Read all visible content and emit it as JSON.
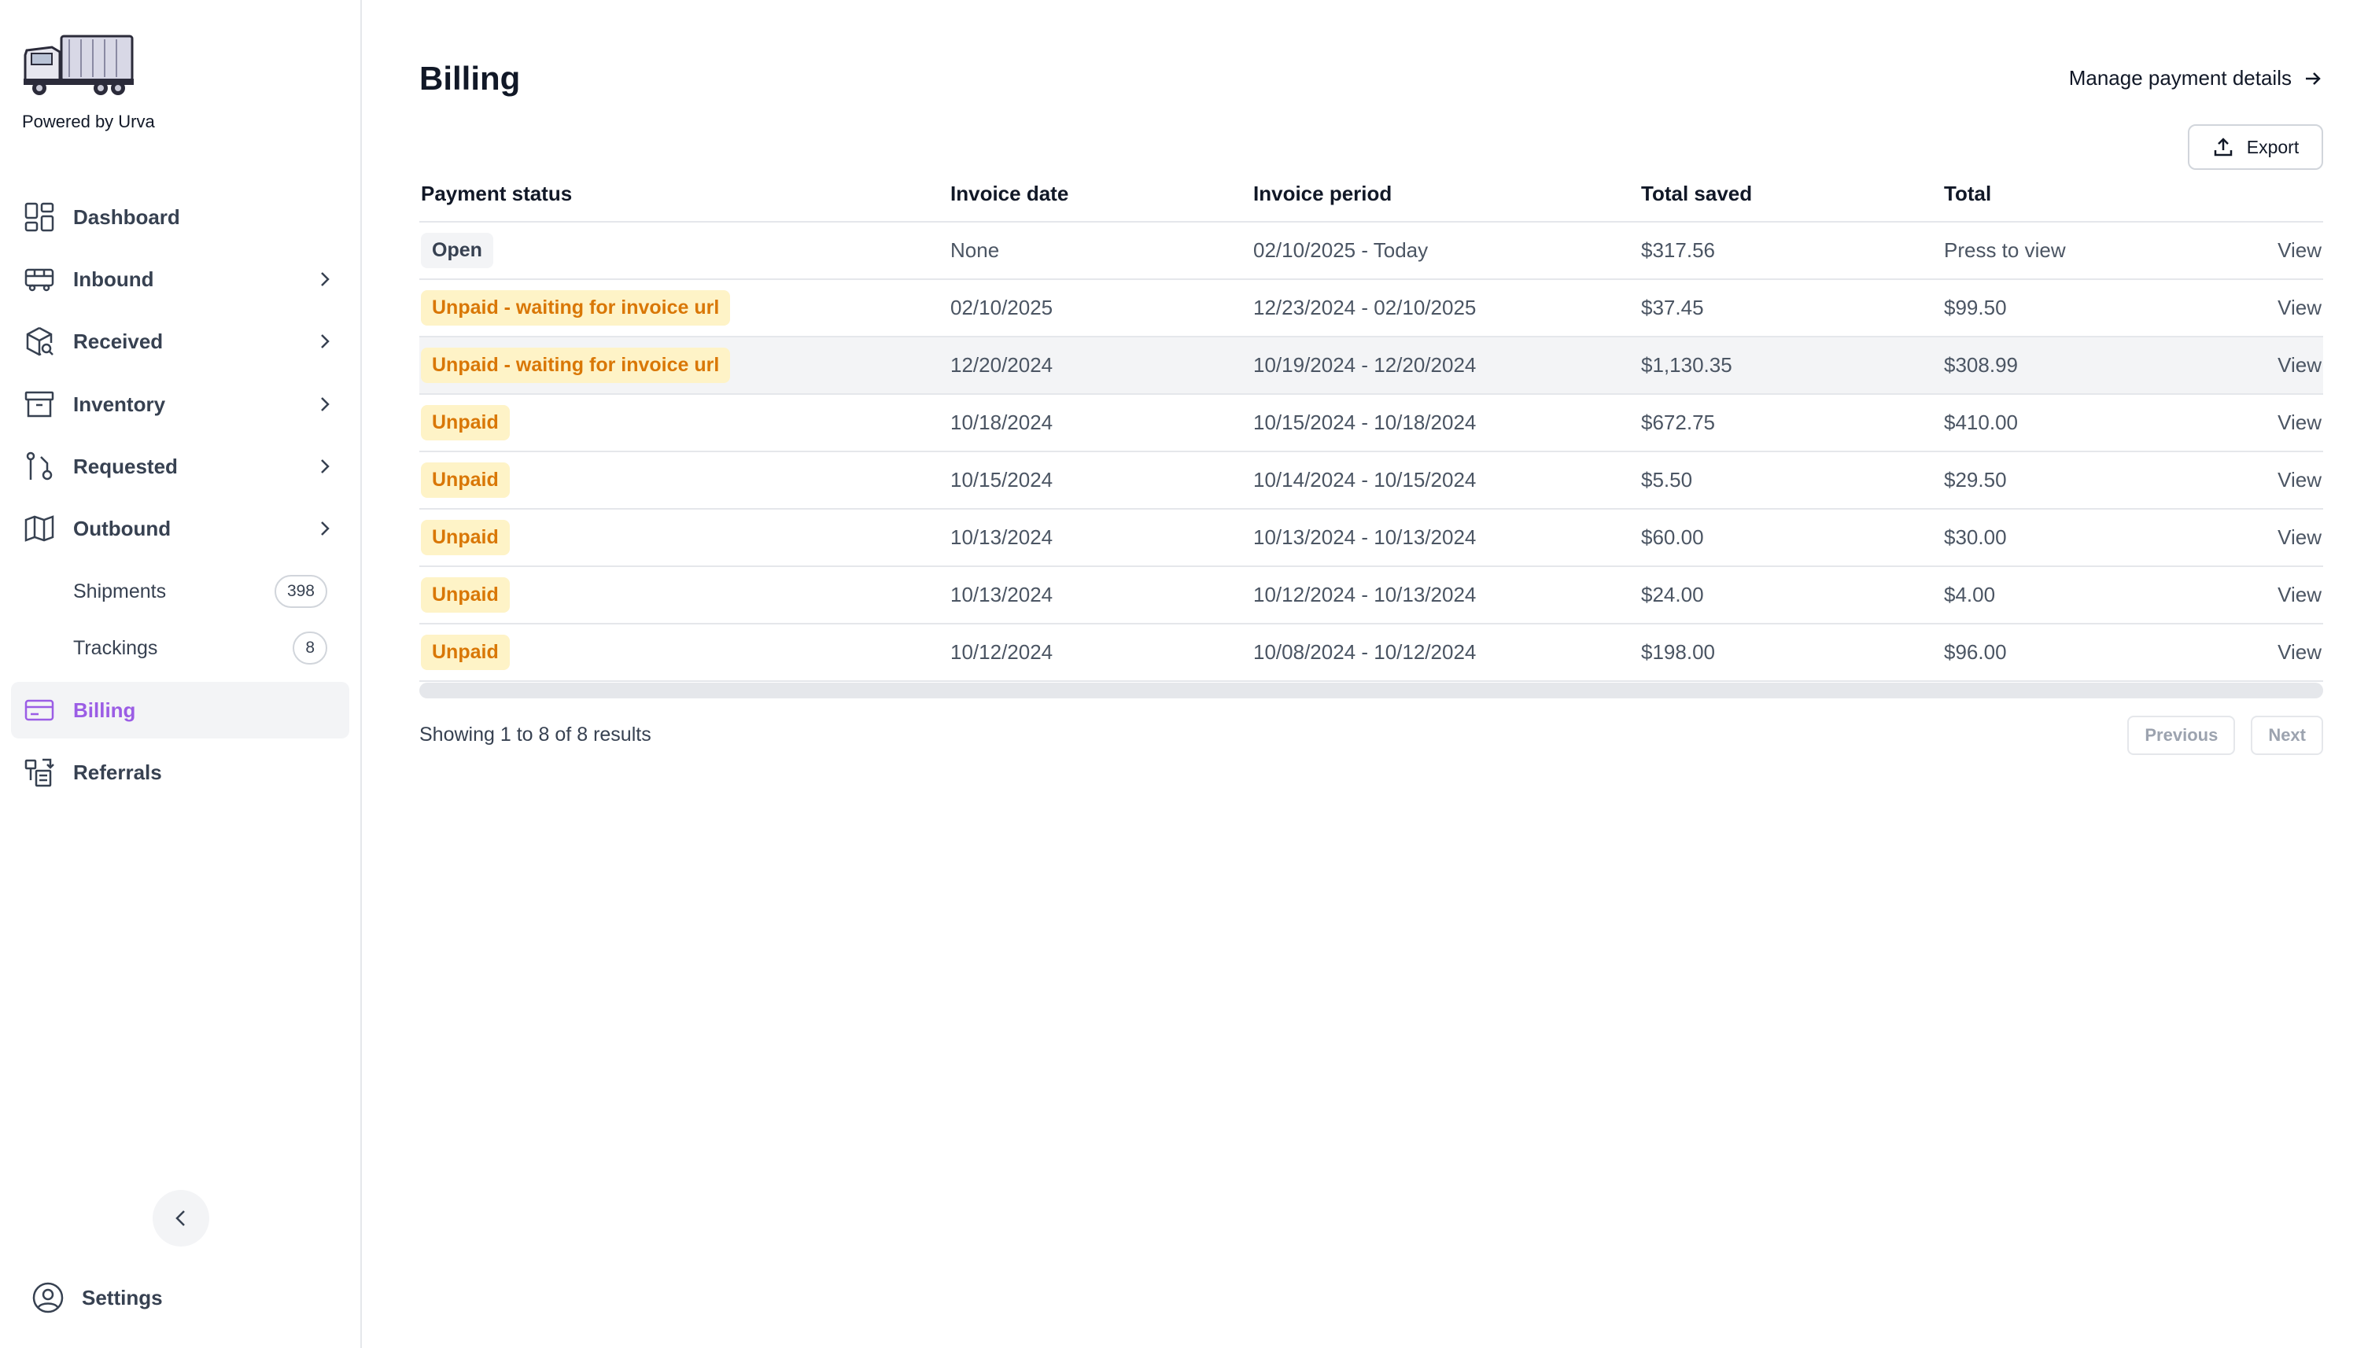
{
  "brand": {
    "tagline": "Powered by Urva",
    "logo_icon": "truck-icon"
  },
  "sidebar": {
    "items": [
      {
        "label": "Dashboard",
        "icon": "dashboard-grid-icon",
        "has_chevron": false
      },
      {
        "label": "Inbound",
        "icon": "bus-icon",
        "has_chevron": true
      },
      {
        "label": "Received",
        "icon": "package-search-icon",
        "has_chevron": true
      },
      {
        "label": "Inventory",
        "icon": "archive-box-icon",
        "has_chevron": true
      },
      {
        "label": "Requested",
        "icon": "git-pull-icon",
        "has_chevron": true
      },
      {
        "label": "Outbound",
        "icon": "map-folded-icon",
        "has_chevron": true
      }
    ],
    "sub_items": [
      {
        "label": "Shipments",
        "count": "398"
      },
      {
        "label": "Trackings",
        "count": "8"
      }
    ],
    "billing": {
      "label": "Billing",
      "icon": "credit-card-icon",
      "active": true
    },
    "referrals": {
      "label": "Referrals",
      "icon": "referral-icon"
    },
    "settings": {
      "label": "Settings",
      "icon": "user-circle-icon"
    },
    "collapse_icon": "chevron-left-icon"
  },
  "header": {
    "title": "Billing",
    "manage_link": "Manage payment details",
    "export_label": "Export"
  },
  "table": {
    "columns": [
      "Payment status",
      "Invoice date",
      "Invoice period",
      "Total saved",
      "Total",
      ""
    ],
    "rows": [
      {
        "status": "Open",
        "status_type": "open",
        "invoice_date": "None",
        "invoice_period": "02/10/2025 - Today",
        "total_saved": "$317.56",
        "total": "Press to view",
        "action": "View",
        "highlighted": false
      },
      {
        "status": "Unpaid - waiting for invoice url",
        "status_type": "unpaid",
        "invoice_date": "02/10/2025",
        "invoice_period": "12/23/2024 - 02/10/2025",
        "total_saved": "$37.45",
        "total": "$99.50",
        "action": "View",
        "highlighted": false
      },
      {
        "status": "Unpaid - waiting for invoice url",
        "status_type": "unpaid",
        "invoice_date": "12/20/2024",
        "invoice_period": "10/19/2024 - 12/20/2024",
        "total_saved": "$1,130.35",
        "total": "$308.99",
        "action": "View",
        "highlighted": true
      },
      {
        "status": "Unpaid",
        "status_type": "unpaid",
        "invoice_date": "10/18/2024",
        "invoice_period": "10/15/2024 - 10/18/2024",
        "total_saved": "$672.75",
        "total": "$410.00",
        "action": "View",
        "highlighted": false
      },
      {
        "status": "Unpaid",
        "status_type": "unpaid",
        "invoice_date": "10/15/2024",
        "invoice_period": "10/14/2024 - 10/15/2024",
        "total_saved": "$5.50",
        "total": "$29.50",
        "action": "View",
        "highlighted": false
      },
      {
        "status": "Unpaid",
        "status_type": "unpaid",
        "invoice_date": "10/13/2024",
        "invoice_period": "10/13/2024 - 10/13/2024",
        "total_saved": "$60.00",
        "total": "$30.00",
        "action": "View",
        "highlighted": false
      },
      {
        "status": "Unpaid",
        "status_type": "unpaid",
        "invoice_date": "10/13/2024",
        "invoice_period": "10/12/2024 - 10/13/2024",
        "total_saved": "$24.00",
        "total": "$4.00",
        "action": "View",
        "highlighted": false
      },
      {
        "status": "Unpaid",
        "status_type": "unpaid",
        "invoice_date": "10/12/2024",
        "invoice_period": "10/08/2024 - 10/12/2024",
        "total_saved": "$198.00",
        "total": "$96.00",
        "action": "View",
        "highlighted": false
      }
    ]
  },
  "pagination": {
    "summary_prefix": "Showing",
    "from": "1",
    "to_word": "to",
    "to": "8",
    "of_word": "of",
    "total": "8",
    "suffix": "results",
    "previous": "Previous",
    "next": "Next"
  },
  "colors": {
    "accent": "#9b5de5",
    "unpaid_bg": "#fef3c7",
    "unpaid_text": "#d97706",
    "open_bg": "#f3f4f6"
  }
}
